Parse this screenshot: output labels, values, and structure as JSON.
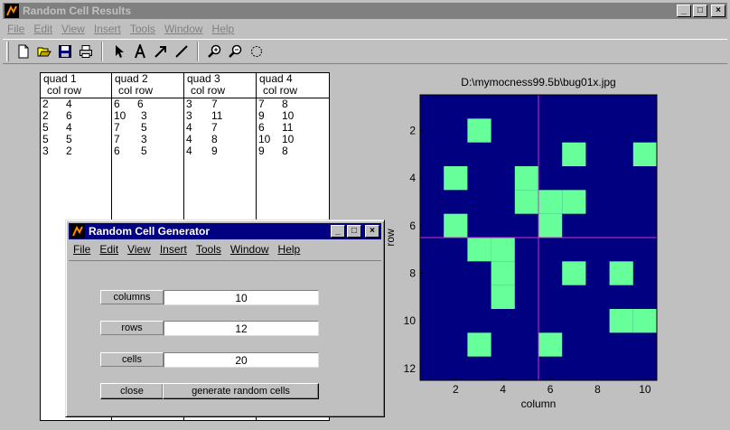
{
  "main_window": {
    "title": "Random Cell Results",
    "menu": [
      "File",
      "Edit",
      "View",
      "Insert",
      "Tools",
      "Window",
      "Help"
    ],
    "controls": {
      "minimize": "_",
      "maximize": "□",
      "close": "×"
    }
  },
  "toolbar_icons": [
    "new-file-icon",
    "open-file-icon",
    "save-icon",
    "print-icon",
    "arrow-pointer-icon",
    "text-icon",
    "arrow-line-icon",
    "line-icon",
    "zoom-in-icon",
    "zoom-out-icon",
    "rotate-icon"
  ],
  "results_table": {
    "quads": [
      {
        "name": "quad 1",
        "header": "col row",
        "rows": [
          [
            "2",
            "4"
          ],
          [
            "2",
            "6"
          ],
          [
            "5",
            "4"
          ],
          [
            "5",
            "5"
          ],
          [
            "3",
            "2"
          ]
        ]
      },
      {
        "name": "quad 2",
        "header": "col row",
        "rows": [
          [
            "6",
            "6"
          ],
          [
            "10",
            "3"
          ],
          [
            "7",
            "5"
          ],
          [
            "7",
            "3"
          ],
          [
            "6",
            "5"
          ]
        ]
      },
      {
        "name": "quad 3",
        "header": "col row",
        "rows": [
          [
            "3",
            "7"
          ],
          [
            "3",
            "11"
          ],
          [
            "4",
            "7"
          ],
          [
            "4",
            "8"
          ],
          [
            "4",
            "9"
          ]
        ]
      },
      {
        "name": "quad 4",
        "header": "col row",
        "rows": [
          [
            "7",
            "8"
          ],
          [
            "9",
            "10"
          ],
          [
            "6",
            "11"
          ],
          [
            "10",
            "10"
          ],
          [
            "9",
            "8"
          ]
        ]
      }
    ]
  },
  "plot": {
    "title": "D:\\mymocness99.5b\\bug01x.jpg",
    "xlabel": "column",
    "ylabel": "row",
    "xticks": [
      "2",
      "4",
      "6",
      "8",
      "10"
    ],
    "yticks": [
      "2",
      "4",
      "6",
      "8",
      "10",
      "12"
    ],
    "colors": {
      "background": "#000080",
      "cell": "#66ff99",
      "divider": "#cc33cc"
    }
  },
  "chart_data": {
    "type": "heatmap",
    "title": "D:\\mymocness99.5b\\bug01x.jpg",
    "xlabel": "column",
    "ylabel": "row",
    "xlim": [
      0.5,
      10.5
    ],
    "ylim": [
      0.5,
      12.5
    ],
    "grid": false,
    "divider_x": 5.5,
    "divider_y": 6.5,
    "cells": [
      [
        3,
        2
      ],
      [
        7,
        3
      ],
      [
        10,
        3
      ],
      [
        2,
        4
      ],
      [
        5,
        4
      ],
      [
        5,
        5
      ],
      [
        6,
        5
      ],
      [
        7,
        5
      ],
      [
        2,
        6
      ],
      [
        6,
        6
      ],
      [
        3,
        7
      ],
      [
        4,
        7
      ],
      [
        4,
        8
      ],
      [
        7,
        8
      ],
      [
        9,
        8
      ],
      [
        4,
        9
      ],
      [
        9,
        10
      ],
      [
        10,
        10
      ],
      [
        3,
        11
      ],
      [
        6,
        11
      ]
    ]
  },
  "dialog": {
    "title": "Random Cell Generator",
    "menu": [
      "File",
      "Edit",
      "View",
      "Insert",
      "Tools",
      "Window",
      "Help"
    ],
    "controls": {
      "minimize": "_",
      "maximize": "□",
      "close": "×"
    },
    "fields": [
      {
        "label": "columns",
        "value": "10"
      },
      {
        "label": "rows",
        "value": "12"
      },
      {
        "label": "cells",
        "value": "20"
      }
    ],
    "buttons": {
      "close": "close",
      "generate": "generate random cells"
    }
  }
}
